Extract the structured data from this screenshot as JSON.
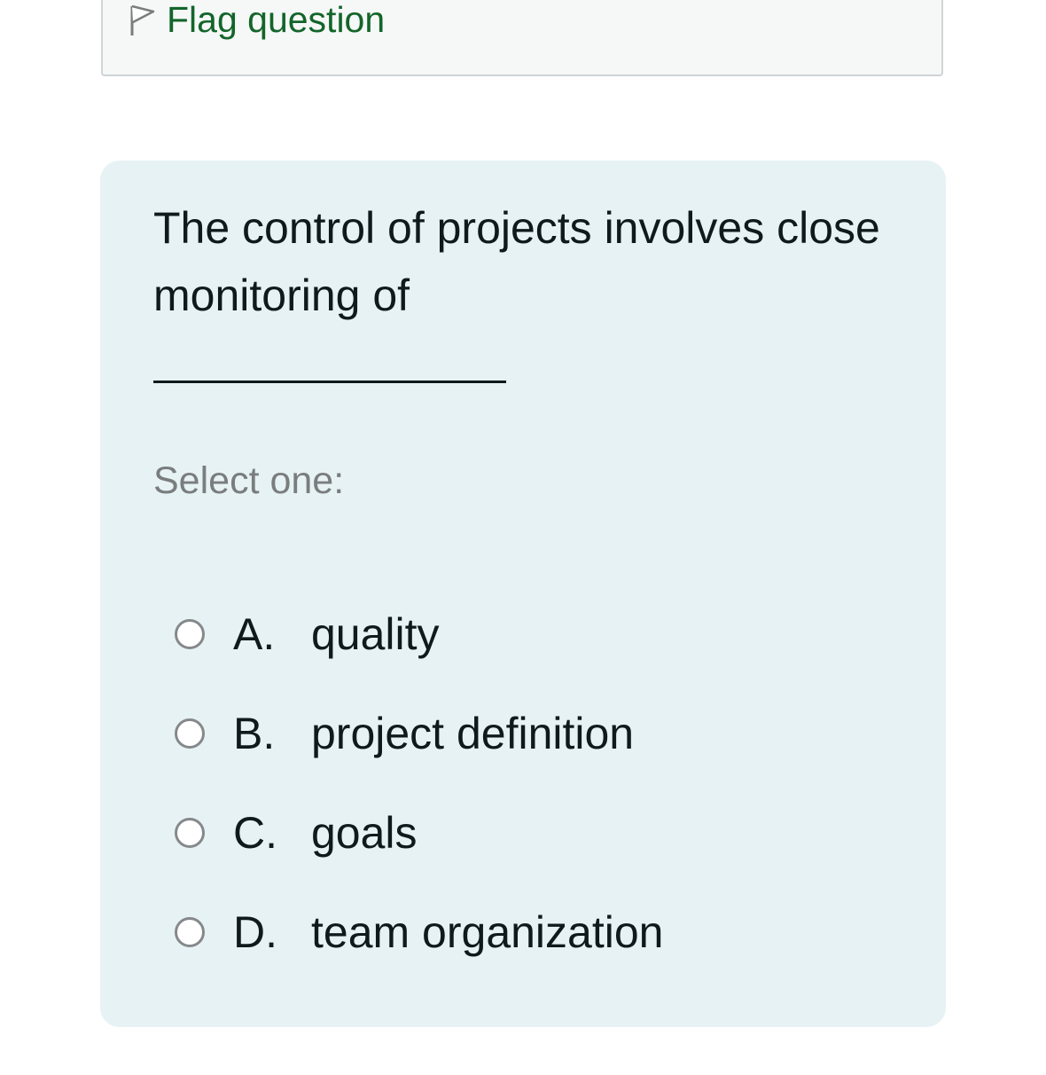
{
  "flag": {
    "label": "Flag question",
    "icon": "flag-icon"
  },
  "question": {
    "text": "The control of projects involves close monitoring of",
    "blank": "______________",
    "prompt": "Select one:",
    "options": [
      {
        "letter": "A.",
        "text": "quality",
        "selected": false
      },
      {
        "letter": "B.",
        "text": "project definition",
        "selected": false
      },
      {
        "letter": "C.",
        "text": "goals",
        "selected": false
      },
      {
        "letter": "D.",
        "text": "team organization",
        "selected": false
      }
    ]
  },
  "colors": {
    "flag_link": "#13652a",
    "panel_bg": "#e7f2f4",
    "prompt_text": "#7a7d7e"
  }
}
